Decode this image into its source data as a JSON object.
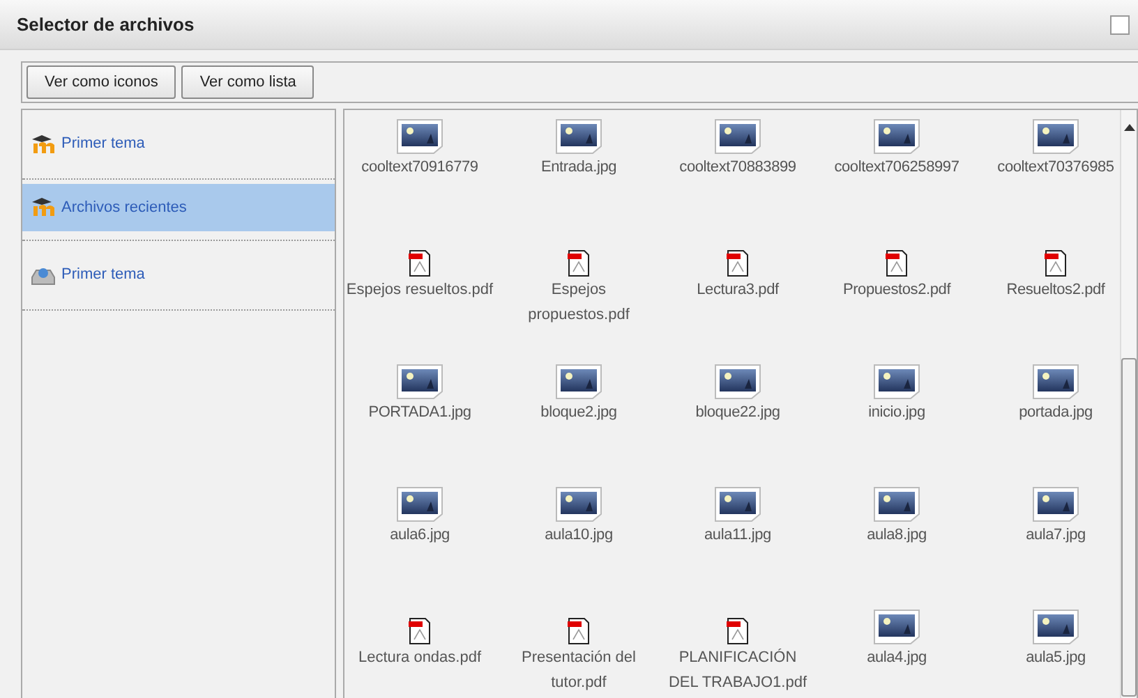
{
  "window": {
    "title": "Selector de archivos"
  },
  "view_buttons": [
    "Ver como iconos",
    "Ver como lista"
  ],
  "sidebar": {
    "items": [
      {
        "label": "Primer tema",
        "kind": "moodle",
        "selected": false
      },
      {
        "label": "Archivos recientes",
        "kind": "moodle",
        "selected": true
      },
      {
        "label": "Primer tema",
        "kind": "repository",
        "selected": false
      }
    ]
  },
  "files": [
    {
      "name": "cooltext70916779",
      "kind": "image"
    },
    {
      "name": "Entrada.jpg",
      "kind": "image"
    },
    {
      "name": "cooltext70883899",
      "kind": "image"
    },
    {
      "name": "cooltext706258997",
      "kind": "image"
    },
    {
      "name": "cooltext70376985",
      "kind": "image"
    },
    {
      "name": "Espejos resueltos.pdf",
      "kind": "pdf"
    },
    {
      "name": "Espejos propuestos.pdf",
      "kind": "pdf"
    },
    {
      "name": "Lectura3.pdf",
      "kind": "pdf"
    },
    {
      "name": "Propuestos2.pdf",
      "kind": "pdf"
    },
    {
      "name": "Resueltos2.pdf",
      "kind": "pdf"
    },
    {
      "name": "PORTADA1.jpg",
      "kind": "image"
    },
    {
      "name": "bloque2.jpg",
      "kind": "image"
    },
    {
      "name": "bloque22.jpg",
      "kind": "image"
    },
    {
      "name": "inicio.jpg",
      "kind": "image"
    },
    {
      "name": "portada.jpg",
      "kind": "image"
    },
    {
      "name": "aula6.jpg",
      "kind": "image"
    },
    {
      "name": "aula10.jpg",
      "kind": "image"
    },
    {
      "name": "aula11.jpg",
      "kind": "image"
    },
    {
      "name": "aula8.jpg",
      "kind": "image"
    },
    {
      "name": "aula7.jpg",
      "kind": "image"
    },
    {
      "name": "Lectura ondas.pdf",
      "kind": "pdf"
    },
    {
      "name": "Presentación del tutor.pdf",
      "kind": "pdf"
    },
    {
      "name": "PLANIFICACIÓN DEL TRABAJO1.pdf",
      "kind": "pdf"
    },
    {
      "name": "aula4.jpg",
      "kind": "image"
    },
    {
      "name": "aula5.jpg",
      "kind": "image"
    }
  ]
}
